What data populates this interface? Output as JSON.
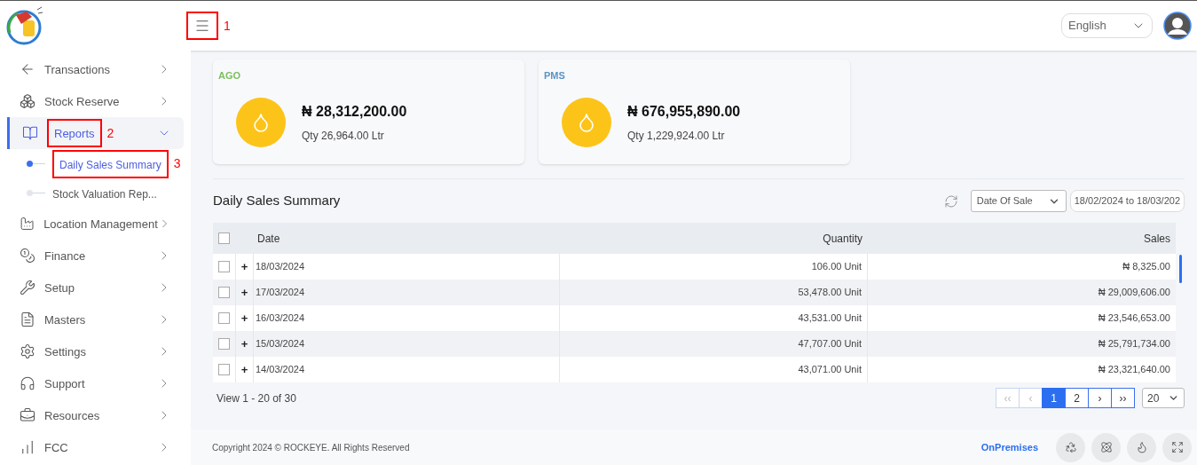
{
  "header": {
    "menu_annotation": "1",
    "language": "English"
  },
  "sidebar": {
    "items": [
      {
        "label": "Transactions",
        "selected": false,
        "expanded": false
      },
      {
        "label": "Stock Reserve",
        "selected": false,
        "expanded": false
      },
      {
        "label": "Reports",
        "selected": true,
        "expanded": true,
        "annotation": "2",
        "children": [
          {
            "label": "Daily Sales Summary",
            "selected": true,
            "annotation": "3"
          },
          {
            "label": "Stock Valuation Rep...",
            "selected": false
          }
        ]
      },
      {
        "label": "Location Management",
        "selected": false,
        "expanded": false
      },
      {
        "label": "Finance",
        "selected": false,
        "expanded": false
      },
      {
        "label": "Setup",
        "selected": false,
        "expanded": false
      },
      {
        "label": "Masters",
        "selected": false,
        "expanded": false
      },
      {
        "label": "Settings",
        "selected": false,
        "expanded": false
      },
      {
        "label": "Support",
        "selected": false,
        "expanded": false
      },
      {
        "label": "Resources",
        "selected": false,
        "expanded": false
      },
      {
        "label": "FCC",
        "selected": false,
        "expanded": false
      }
    ]
  },
  "cards": [
    {
      "product": "AGO",
      "color": "#7cbd5e",
      "amount": "₦ 28,312,200.00",
      "qty": "Qty 26,964.00 Ltr"
    },
    {
      "product": "PMS",
      "color": "#5b93c4",
      "amount": "₦ 676,955,890.00",
      "qty": "Qty 1,229,924.00 Ltr"
    }
  ],
  "report": {
    "title": "Daily Sales Summary",
    "filter": "Date Of Sale",
    "date_range": "18/02/2024 to 18/03/202",
    "table": {
      "columns": [
        "Date",
        "Quantity",
        "Sales"
      ],
      "all_checked": false,
      "rows": [
        {
          "checked": false,
          "expand": "+",
          "cells": [
            "18/03/2024",
            "106.00 Unit",
            "₦ 8,325.00"
          ]
        },
        {
          "checked": false,
          "expand": "+",
          "cells": [
            "17/03/2024",
            "53,478.00 Unit",
            "₦ 29,009,606.00"
          ]
        },
        {
          "checked": false,
          "expand": "+",
          "cells": [
            "16/03/2024",
            "43,531.00 Unit",
            "₦ 23,546,653.00"
          ]
        },
        {
          "checked": false,
          "expand": "+",
          "cells": [
            "15/03/2024",
            "47,707.00 Unit",
            "₦ 25,791,734.00"
          ]
        },
        {
          "checked": false,
          "expand": "+",
          "cells": [
            "14/03/2024",
            "43,071.00 Unit",
            "₦ 23,321,640.00"
          ]
        }
      ]
    },
    "view_info": "View 1 - 20 of 30",
    "pager": [
      {
        "label": "‹‹",
        "selected": false,
        "disabled": true
      },
      {
        "label": "‹",
        "selected": false,
        "disabled": true
      },
      {
        "label": "1",
        "selected": true,
        "disabled": false
      },
      {
        "label": "2",
        "selected": false,
        "disabled": false
      },
      {
        "label": "›",
        "selected": false,
        "disabled": false
      },
      {
        "label": "››",
        "selected": false,
        "disabled": false
      }
    ],
    "page_size": "20"
  },
  "footer": {
    "copyright": "Copyright 2024 © ROCKEYE. All Rights Reserved",
    "mode": "OnPremises"
  }
}
